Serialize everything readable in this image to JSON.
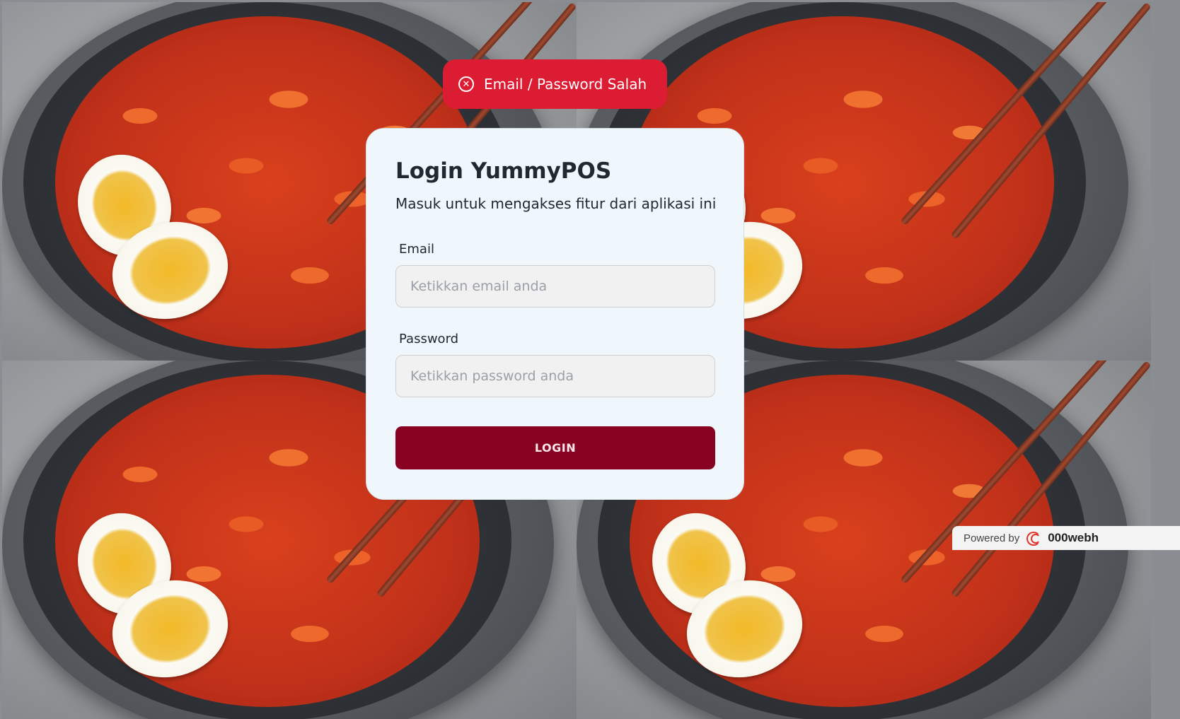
{
  "toast": {
    "icon": "close-circle-icon",
    "message": "Email / Password Salah",
    "color": "#dc1c33"
  },
  "login": {
    "title": "Login YummyPOS",
    "subtitle": "Masuk untuk mengakses fitur dari aplikasi ini",
    "email_label": "Email",
    "email_placeholder": "Ketikkan email anda",
    "password_label": "Password",
    "password_placeholder": "Ketikkan password anda",
    "button_label": "LOGIN",
    "button_color": "#880322"
  },
  "footer": {
    "powered_by": "Powered by",
    "brand": "000webh"
  }
}
